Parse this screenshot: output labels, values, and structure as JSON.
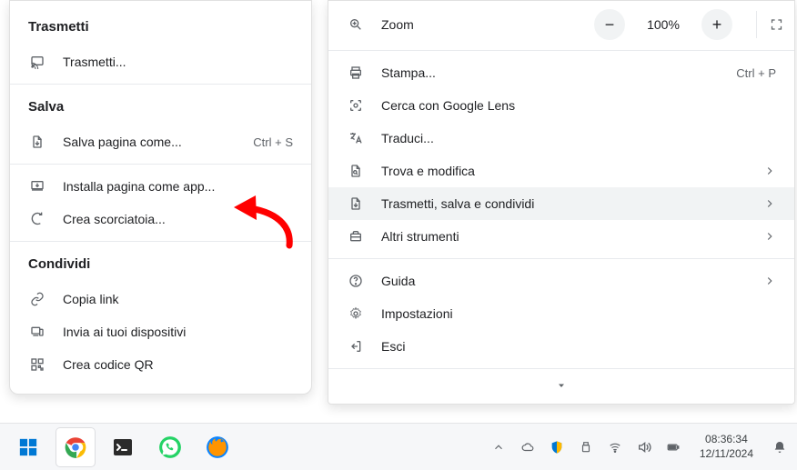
{
  "left_panel": {
    "sections": {
      "trasmetti": {
        "title": "Trasmetti",
        "items": [
          {
            "label": "Trasmetti..."
          }
        ]
      },
      "salva": {
        "title": "Salva",
        "items": [
          {
            "label": "Salva pagina come...",
            "shortcut": "Ctrl + S"
          }
        ]
      },
      "app": {
        "items": [
          {
            "label": "Installa pagina come app..."
          },
          {
            "label": "Crea scorciatoia..."
          }
        ]
      },
      "condividi": {
        "title": "Condividi",
        "items": [
          {
            "label": "Copia link"
          },
          {
            "label": "Invia ai tuoi dispositivi"
          },
          {
            "label": "Crea codice QR"
          }
        ]
      }
    }
  },
  "right_panel": {
    "zoom": {
      "label": "Zoom",
      "value": "100%"
    },
    "items": [
      {
        "label": "Stampa...",
        "shortcut": "Ctrl + P"
      },
      {
        "label": "Cerca con Google Lens"
      },
      {
        "label": "Traduci..."
      },
      {
        "label": "Trova e modifica",
        "chevron": true
      },
      {
        "label": "Trasmetti, salva e condividi",
        "chevron": true,
        "hover": true
      },
      {
        "label": "Altri strumenti",
        "chevron": true
      }
    ],
    "items2": [
      {
        "label": "Guida",
        "chevron": true
      },
      {
        "label": "Impostazioni"
      },
      {
        "label": "Esci"
      }
    ]
  },
  "taskbar": {
    "time": "08:36:34",
    "date": "12/11/2024"
  }
}
